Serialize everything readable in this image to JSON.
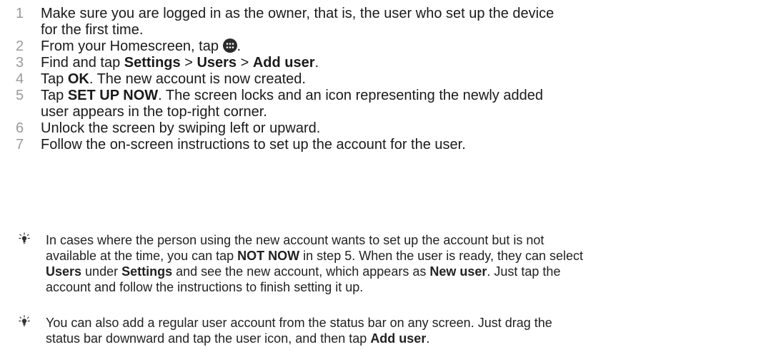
{
  "steps": [
    {
      "num": "1",
      "line1": "Make sure you are logged in as the owner, that is, the user who set up the device",
      "line2": "for the first time."
    },
    {
      "num": "2",
      "before": "From your Homescreen, tap ",
      "icon": "apps-icon",
      "after": "."
    },
    {
      "num": "3",
      "t1": "Find and tap ",
      "b1": "Settings",
      "t2": " > ",
      "b2": "Users",
      "t3": " > ",
      "b3": "Add user",
      "t4": "."
    },
    {
      "num": "4",
      "t1": "Tap ",
      "b1": "OK",
      "t2": ". The new account is now created."
    },
    {
      "num": "5",
      "t1": "Tap ",
      "b1": "SET UP NOW",
      "t2": ". The screen locks and an icon representing the newly added",
      "line2": "user appears in the top-right corner."
    },
    {
      "num": "6",
      "text": "Unlock the screen by swiping left or upward."
    },
    {
      "num": "7",
      "text": "Follow the on-screen instructions to set up the account for the user."
    }
  ],
  "tips": [
    {
      "icon": "lightbulb-tip-icon",
      "l1": "In cases where the person using the new account wants to set up the account but is not",
      "l2a": "available at the time, you can tap ",
      "l2b": "NOT NOW",
      "l2c": " in step 5. When the user is ready, they can select",
      "l3a": "Users",
      "l3b": " under ",
      "l3c": "Settings",
      "l3d": " and see the new account, which appears as ",
      "l3e": "New user",
      "l3f": ". Just tap the",
      "l4": "account and follow the instructions to finish setting it up."
    },
    {
      "icon": "lightbulb-tip-icon",
      "l1": "You can also add a regular user account from the status bar on any screen. Just drag the",
      "l2a": "status bar downward and tap the user icon, and then tap ",
      "l2b": "Add user",
      "l2c": "."
    }
  ],
  "colors": {
    "step_number": "#9a9a9a",
    "text": "#1a1a1a",
    "icon": "#2b2b2b"
  }
}
